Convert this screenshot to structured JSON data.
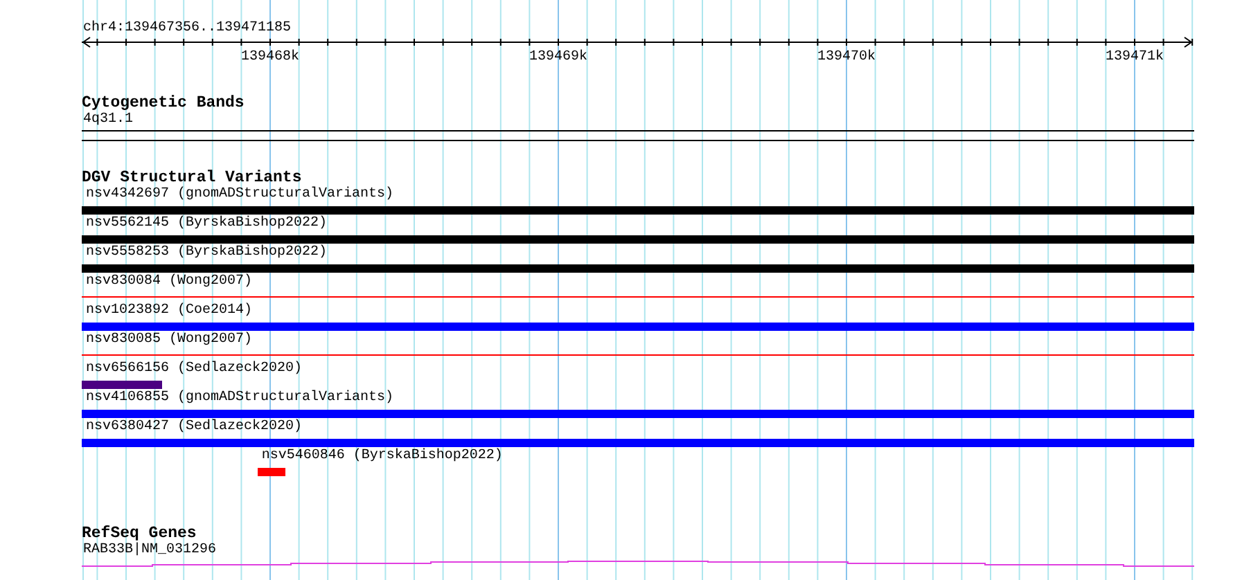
{
  "ruler": {
    "title": "chr4:139467356..139471185",
    "labels": [
      "139468k",
      "139469k",
      "139470k",
      "139471k"
    ]
  },
  "tracks": [
    {
      "kind": "bands",
      "title": "Cytogenetic Bands",
      "features": [
        {
          "label": "4q31.1"
        }
      ]
    },
    {
      "kind": "variants",
      "title": "DGV Structural Variants",
      "features": [
        {
          "label": "nsv4342697 (gnomADStructuralVariants)",
          "kind": "thick",
          "color": "#000000"
        },
        {
          "label": "nsv5562145 (ByrskaBishop2022)",
          "kind": "thick",
          "color": "#000000"
        },
        {
          "label": "nsv5558253 (ByrskaBishop2022)",
          "kind": "thick",
          "color": "#000000"
        },
        {
          "label": "nsv830084 (Wong2007)",
          "kind": "thin",
          "color": "#ff0000"
        },
        {
          "label": "nsv1023892 (Coe2014)",
          "kind": "thick",
          "color": "#0000ff"
        },
        {
          "label": "nsv830085 (Wong2007)",
          "kind": "thin",
          "color": "#ff0000"
        },
        {
          "label": "nsv6566156 (Sedlazeck2020)",
          "kind": "thick",
          "color": "#4b0082"
        },
        {
          "label": "nsv4106855 (gnomADStructuralVariants)",
          "kind": "thick",
          "color": "#0000ff"
        },
        {
          "label": "nsv6380427 (Sedlazeck2020)",
          "kind": "thick",
          "color": "#0000ff"
        },
        {
          "label": "nsv5460846 (ByrskaBishop2022)",
          "kind": "thick",
          "color": "#ff0000"
        }
      ]
    },
    {
      "kind": "genes",
      "title": "RefSeq Genes",
      "features": [
        {
          "label": "RAB33B|NM_031296"
        }
      ]
    }
  ]
}
